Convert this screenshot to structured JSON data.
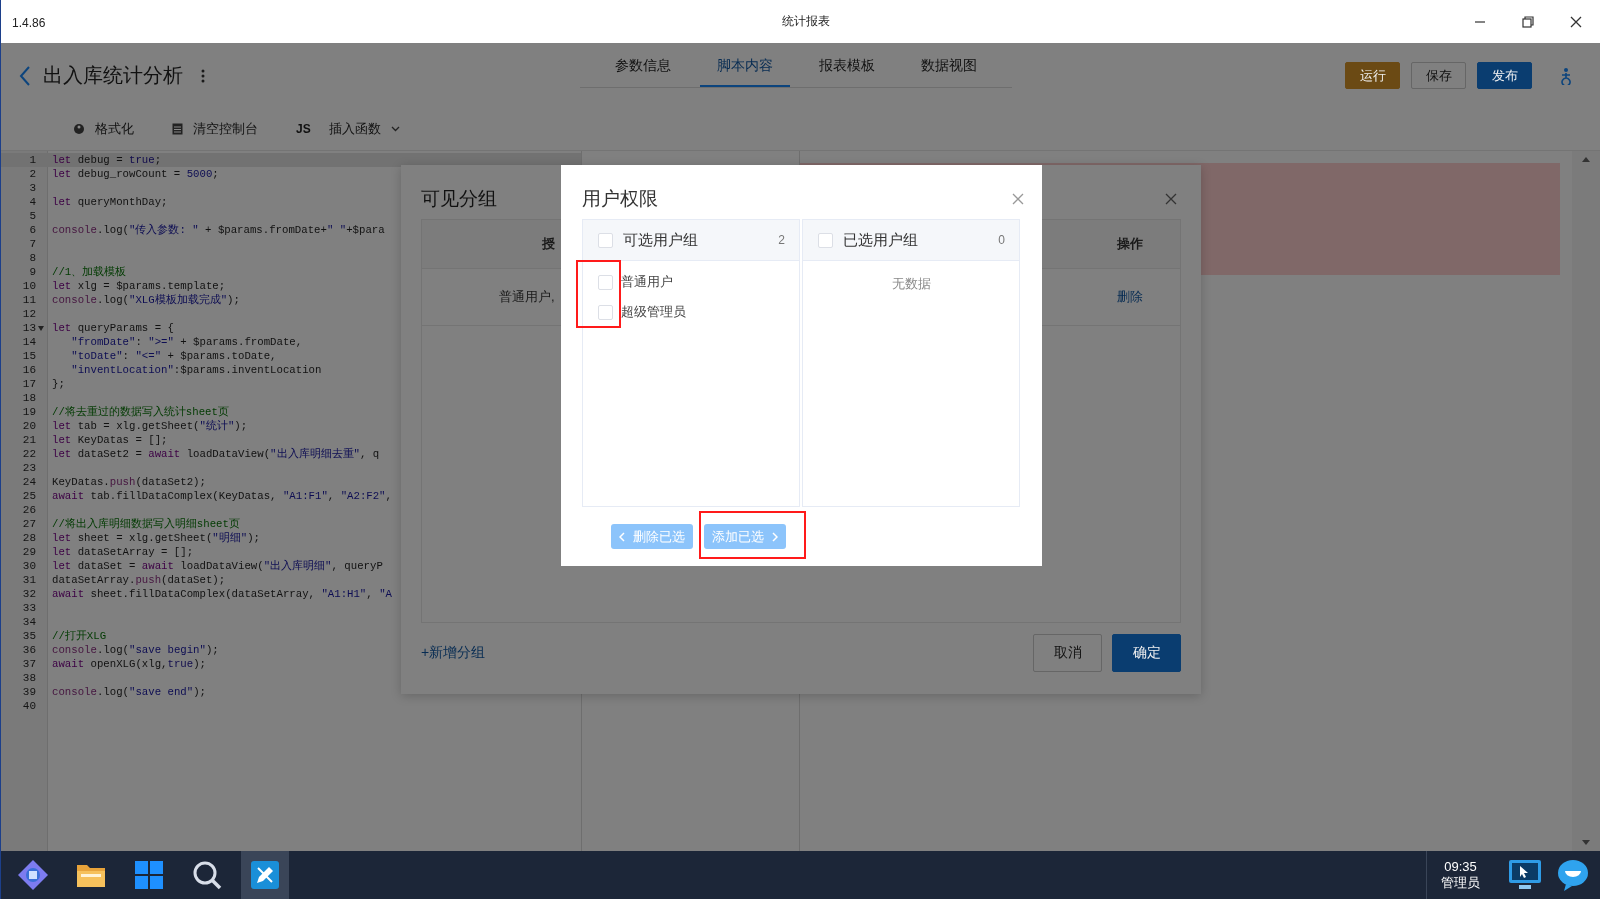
{
  "window": {
    "version": "1.4.86",
    "title": "统计报表"
  },
  "header": {
    "title": "出入库统计分析",
    "tabs": [
      {
        "label": "参数信息",
        "selected": false
      },
      {
        "label": "脚本内容",
        "selected": true
      },
      {
        "label": "报表模板",
        "selected": false
      },
      {
        "label": "数据视图",
        "selected": false
      }
    ],
    "buttons": [
      {
        "label": "运行",
        "kind": "warning"
      },
      {
        "label": "保存",
        "kind": "default"
      },
      {
        "label": "发布",
        "kind": "primary"
      }
    ]
  },
  "toolbar": [
    {
      "label": "格式化",
      "kind": "format"
    },
    {
      "label": "清空控制台",
      "kind": "clear"
    },
    {
      "badge": "JS",
      "label": "插入函数",
      "kind": "insert"
    }
  ],
  "editor": {
    "lines": [
      {
        "number": "1",
        "active": true,
        "fold_marker": false,
        "tokens": [
          {
            "kind": "kw",
            "text": "let"
          },
          {
            "kind": "plain",
            "text": " debug = "
          },
          {
            "kind": "atom",
            "text": "true"
          },
          {
            "kind": "plain",
            "text": ";"
          }
        ]
      },
      {
        "number": "2",
        "active": false,
        "fold_marker": false,
        "tokens": [
          {
            "kind": "kw",
            "text": "let"
          },
          {
            "kind": "plain",
            "text": " debug_rowCount = "
          },
          {
            "kind": "num",
            "text": "5000"
          },
          {
            "kind": "plain",
            "text": ";"
          }
        ]
      },
      {
        "number": "3",
        "active": false,
        "fold_marker": false
      },
      {
        "number": "4",
        "active": false,
        "fold_marker": false,
        "tokens": [
          {
            "kind": "kw",
            "text": "let"
          },
          {
            "kind": "plain",
            "text": " queryMonthDay;"
          }
        ]
      },
      {
        "number": "5",
        "active": false,
        "fold_marker": false
      },
      {
        "number": "6",
        "active": false,
        "fold_marker": false,
        "tokens": [
          {
            "kind": "var",
            "text": "console"
          },
          {
            "kind": "plain",
            "text": ".log("
          },
          {
            "kind": "str",
            "text": "\"传入参数: \""
          },
          {
            "kind": "plain",
            "text": " + $params.fromDate+"
          },
          {
            "kind": "str",
            "text": "\" \""
          },
          {
            "kind": "plain",
            "text": "+$para"
          }
        ]
      },
      {
        "number": "7",
        "active": false,
        "fold_marker": false
      },
      {
        "number": "8",
        "active": false,
        "fold_marker": false
      },
      {
        "number": "9",
        "active": false,
        "fold_marker": false,
        "tokens": [
          {
            "kind": "comment",
            "text": "//1、加载模板"
          }
        ]
      },
      {
        "number": "10",
        "active": false,
        "fold_marker": false,
        "tokens": [
          {
            "kind": "kw",
            "text": "let"
          },
          {
            "kind": "plain",
            "text": " xlg = $params.template;"
          }
        ]
      },
      {
        "number": "11",
        "active": false,
        "fold_marker": false,
        "tokens": [
          {
            "kind": "var",
            "text": "console"
          },
          {
            "kind": "plain",
            "text": ".log("
          },
          {
            "kind": "str",
            "text": "\"XLG模板加载完成\""
          },
          {
            "kind": "plain",
            "text": ");"
          }
        ]
      },
      {
        "number": "12",
        "active": false,
        "fold_marker": false
      },
      {
        "number": "13",
        "active": false,
        "fold_marker": true,
        "tokens": [
          {
            "kind": "kw",
            "text": "let"
          },
          {
            "kind": "plain",
            "text": " queryParams = {"
          }
        ]
      },
      {
        "number": "14",
        "active": false,
        "fold_marker": false,
        "tokens": [
          {
            "kind": "str",
            "text": "   \"fromDate\""
          },
          {
            "kind": "plain",
            "text": ": "
          },
          {
            "kind": "str",
            "text": "\">=\""
          },
          {
            "kind": "plain",
            "text": " + $params.fromDate,"
          }
        ]
      },
      {
        "number": "15",
        "active": false,
        "fold_marker": false,
        "tokens": [
          {
            "kind": "str",
            "text": "   \"toDate\""
          },
          {
            "kind": "plain",
            "text": ": "
          },
          {
            "kind": "str",
            "text": "\"<=\""
          },
          {
            "kind": "plain",
            "text": " + $params.toDate,"
          }
        ]
      },
      {
        "number": "16",
        "active": false,
        "fold_marker": false,
        "tokens": [
          {
            "kind": "str",
            "text": "   \"inventLocation\""
          },
          {
            "kind": "plain",
            "text": ":$params.inventLocation"
          }
        ]
      },
      {
        "number": "17",
        "active": false,
        "fold_marker": false,
        "tokens": [
          {
            "kind": "plain",
            "text": "};"
          }
        ]
      },
      {
        "number": "18",
        "active": false,
        "fold_marker": false
      },
      {
        "number": "19",
        "active": false,
        "fold_marker": false,
        "tokens": [
          {
            "kind": "comment",
            "text": "//将去重过的数据写入统计sheet页"
          }
        ]
      },
      {
        "number": "20",
        "active": false,
        "fold_marker": false,
        "tokens": [
          {
            "kind": "kw",
            "text": "let"
          },
          {
            "kind": "plain",
            "text": " tab = xlg.getSheet("
          },
          {
            "kind": "str",
            "text": "\"统计\""
          },
          {
            "kind": "plain",
            "text": ");"
          }
        ]
      },
      {
        "number": "21",
        "active": false,
        "fold_marker": false,
        "tokens": [
          {
            "kind": "kw",
            "text": "let"
          },
          {
            "kind": "plain",
            "text": " KeyDatas = [];"
          }
        ]
      },
      {
        "number": "22",
        "active": false,
        "fold_marker": false,
        "tokens": [
          {
            "kind": "kw",
            "text": "let"
          },
          {
            "kind": "plain",
            "text": " dataSet2 = "
          },
          {
            "kind": "kw",
            "text": "await"
          },
          {
            "kind": "plain",
            "text": " loadDataView("
          },
          {
            "kind": "str",
            "text": "\"出入库明细去重\""
          },
          {
            "kind": "plain",
            "text": ", q"
          }
        ]
      },
      {
        "number": "23",
        "active": false,
        "fold_marker": false
      },
      {
        "number": "24",
        "active": false,
        "fold_marker": false,
        "tokens": [
          {
            "kind": "plain",
            "text": "KeyDatas."
          },
          {
            "kind": "var",
            "text": "push"
          },
          {
            "kind": "plain",
            "text": "(dataSet2);"
          }
        ]
      },
      {
        "number": "25",
        "active": false,
        "fold_marker": false,
        "tokens": [
          {
            "kind": "kw",
            "text": "await"
          },
          {
            "kind": "plain",
            "text": " tab.fillDataComplex(KeyDatas, "
          },
          {
            "kind": "str",
            "text": "\"A1:F1\""
          },
          {
            "kind": "plain",
            "text": ", "
          },
          {
            "kind": "str",
            "text": "\"A2:F2\""
          },
          {
            "kind": "plain",
            "text": ","
          }
        ]
      },
      {
        "number": "26",
        "active": false,
        "fold_marker": false
      },
      {
        "number": "27",
        "active": false,
        "fold_marker": false,
        "tokens": [
          {
            "kind": "comment",
            "text": "//将出入库明细数据写入明细sheet页"
          }
        ]
      },
      {
        "number": "28",
        "active": false,
        "fold_marker": false,
        "tokens": [
          {
            "kind": "kw",
            "text": "let"
          },
          {
            "kind": "plain",
            "text": " sheet = xlg.getSheet("
          },
          {
            "kind": "str",
            "text": "\"明细\""
          },
          {
            "kind": "plain",
            "text": ");"
          }
        ]
      },
      {
        "number": "29",
        "active": false,
        "fold_marker": false,
        "tokens": [
          {
            "kind": "kw",
            "text": "let"
          },
          {
            "kind": "plain",
            "text": " dataSetArray = [];"
          }
        ]
      },
      {
        "number": "30",
        "active": false,
        "fold_marker": false,
        "tokens": [
          {
            "kind": "kw",
            "text": "let"
          },
          {
            "kind": "plain",
            "text": " dataSet = "
          },
          {
            "kind": "kw",
            "text": "await"
          },
          {
            "kind": "plain",
            "text": " loadDataView("
          },
          {
            "kind": "str",
            "text": "\"出入库明细\""
          },
          {
            "kind": "plain",
            "text": ", queryP"
          }
        ]
      },
      {
        "number": "31",
        "active": false,
        "fold_marker": false,
        "tokens": [
          {
            "kind": "plain",
            "text": "dataSetArray."
          },
          {
            "kind": "var",
            "text": "push"
          },
          {
            "kind": "plain",
            "text": "(dataSet);"
          }
        ]
      },
      {
        "number": "32",
        "active": false,
        "fold_marker": false,
        "tokens": [
          {
            "kind": "kw",
            "text": "await"
          },
          {
            "kind": "plain",
            "text": " sheet.fillDataComplex(dataSetArray, "
          },
          {
            "kind": "str",
            "text": "\"A1:H1\""
          },
          {
            "kind": "plain",
            "text": ", "
          },
          {
            "kind": "str",
            "text": "\"A"
          }
        ]
      },
      {
        "number": "33",
        "active": false,
        "fold_marker": false
      },
      {
        "number": "34",
        "active": false,
        "fold_marker": false
      },
      {
        "number": "35",
        "active": false,
        "fold_marker": false,
        "tokens": [
          {
            "kind": "comment",
            "text": "//打开XLG"
          }
        ]
      },
      {
        "number": "36",
        "active": false,
        "fold_marker": false,
        "tokens": [
          {
            "kind": "var",
            "text": "console"
          },
          {
            "kind": "plain",
            "text": ".log("
          },
          {
            "kind": "str",
            "text": "\"save begin\""
          },
          {
            "kind": "plain",
            "text": ");"
          }
        ]
      },
      {
        "number": "37",
        "active": false,
        "fold_marker": false,
        "tokens": [
          {
            "kind": "kw",
            "text": "await"
          },
          {
            "kind": "plain",
            "text": " openXLG(xlg,"
          },
          {
            "kind": "atom",
            "text": "true"
          },
          {
            "kind": "plain",
            "text": ");"
          }
        ]
      },
      {
        "number": "38",
        "active": false,
        "fold_marker": false
      },
      {
        "number": "39",
        "active": false,
        "fold_marker": false,
        "tokens": [
          {
            "kind": "var",
            "text": "console"
          },
          {
            "kind": "plain",
            "text": ".log("
          },
          {
            "kind": "str",
            "text": "\"save end\""
          },
          {
            "kind": "plain",
            "text": ");"
          }
        ]
      },
      {
        "number": "40",
        "active": false,
        "fold_marker": false
      }
    ]
  },
  "groups_dialog": {
    "title": "可见分组",
    "columns": [
      "授",
      "操作"
    ],
    "rows": [
      {
        "groups": "普通用户,",
        "action": "删除"
      }
    ],
    "add_link": "+新增分组",
    "buttons": [
      {
        "label": "取消",
        "kind": "default"
      },
      {
        "label": "确定",
        "kind": "primary"
      }
    ]
  },
  "permission_dialog": {
    "title": "用户权限",
    "source": {
      "title": "可选用户组",
      "count": "2",
      "checked": false,
      "items": [
        {
          "label": "普通用户",
          "checked": false
        },
        {
          "label": "超级管理员",
          "checked": false
        }
      ]
    },
    "target": {
      "title": "已选用户组",
      "count": "0",
      "checked": false,
      "empty_text": "无数据"
    },
    "buttons": [
      {
        "label": "删除已选",
        "kind": "remove",
        "disabled": true
      },
      {
        "label": "添加已选",
        "kind": "add",
        "disabled": true
      }
    ]
  },
  "taskbar": {
    "apps": [
      {
        "kind": "launcher",
        "active": false
      },
      {
        "kind": "files",
        "active": false
      },
      {
        "kind": "start",
        "active": false
      },
      {
        "kind": "search",
        "active": false
      },
      {
        "kind": "editor",
        "active": true
      }
    ],
    "time": "09:35",
    "user": "管理员"
  }
}
